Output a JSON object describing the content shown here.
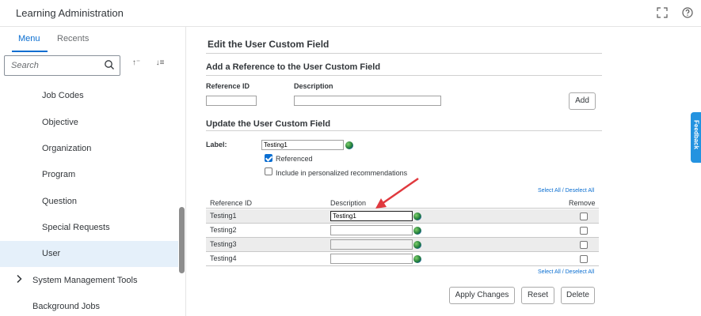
{
  "app": {
    "title": "Learning Administration"
  },
  "sidebar": {
    "tabs": [
      {
        "label": "Menu"
      },
      {
        "label": "Recents"
      }
    ],
    "search": {
      "placeholder": "Search"
    },
    "items": [
      {
        "label": "Job Codes"
      },
      {
        "label": "Objective"
      },
      {
        "label": "Organization"
      },
      {
        "label": "Program"
      },
      {
        "label": "Question"
      },
      {
        "label": "Special Requests"
      },
      {
        "label": "User",
        "selected": true
      },
      {
        "label": "System Management Tools",
        "expandable": true
      },
      {
        "label": "Background Jobs"
      }
    ]
  },
  "main": {
    "page_title": "Edit the User Custom Field",
    "add_section": {
      "title": "Add a Reference to the User Custom Field",
      "ref_id_label": "Reference ID",
      "desc_label": "Description",
      "add_button": "Add"
    },
    "update_section": {
      "title": "Update the User Custom Field",
      "label_label": "Label:",
      "label_value": "Testing1",
      "referenced_label": "Referenced",
      "referenced_checked": true,
      "personalized_label": "Include in personalized recommendations",
      "personalized_checked": false
    },
    "table": {
      "select_all_link": "Select All / Deselect All",
      "columns": [
        "Reference ID",
        "Description",
        "Remove"
      ],
      "rows": [
        {
          "ref_id": "Testing1",
          "description": "Testing1"
        },
        {
          "ref_id": "Testing2",
          "description": ""
        },
        {
          "ref_id": "Testing3",
          "description": ""
        },
        {
          "ref_id": "Testing4",
          "description": ""
        }
      ]
    },
    "buttons": {
      "apply": "Apply Changes",
      "reset": "Reset",
      "delete": "Delete"
    }
  },
  "feedback_tab": {
    "label": "Feedback"
  },
  "colors": {
    "accent": "#0a6ed1",
    "selected_bg": "#e5f0fa",
    "annotation_arrow": "#e0393e"
  }
}
